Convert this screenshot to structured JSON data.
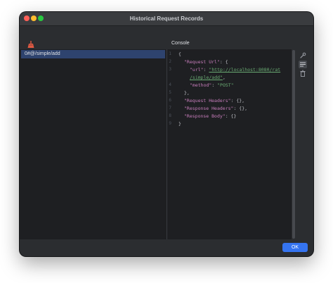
{
  "window": {
    "title": "Historical Request Records"
  },
  "toolbar": {
    "clear_icon": "broom-icon"
  },
  "records": [
    {
      "label": "0#@/simple/add",
      "selected": true
    }
  ],
  "console": {
    "tab_label": "Console",
    "line_numbers": [
      "1",
      "2",
      "3",
      "4",
      "5",
      "6",
      "7",
      "8",
      "9"
    ],
    "lines": [
      {
        "text": "{"
      },
      {
        "key": "\"Request Url\"",
        "rest": ": {"
      },
      {
        "key": "\"url\"",
        "rest": ": ",
        "value": "\"http://localhost:8080/rat",
        "link": true
      },
      {
        "value": "/simple/add\"",
        "link": true,
        "rest": ","
      },
      {
        "key": "\"method\"",
        "rest": ": ",
        "value": "\"POST\""
      },
      {
        "text": "},"
      },
      {
        "key": "\"Request Headers\"",
        "rest": ": {},"
      },
      {
        "key": "\"Response Headers\"",
        "rest": ": {},"
      },
      {
        "key": "\"Response Body\"",
        "rest": ": {}"
      },
      {
        "text": "}"
      }
    ]
  },
  "side_tools": [
    "wrench-icon",
    "soft-wrap-icon",
    "trash-icon"
  ],
  "footer": {
    "ok_label": "OK"
  },
  "colors": {
    "accent": "#3574f0",
    "selection": "#2e436e",
    "json_key": "#c77dbb",
    "json_string": "#6aab73"
  }
}
